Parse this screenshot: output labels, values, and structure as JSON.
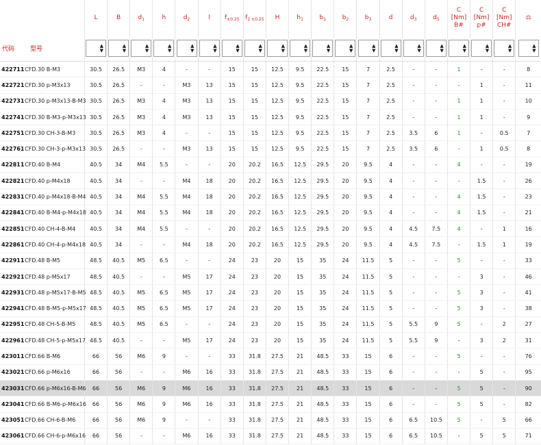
{
  "columns": [
    {
      "key": "L",
      "label": "L"
    },
    {
      "key": "B",
      "label": "B"
    },
    {
      "key": "d1",
      "label": "d",
      "sub": "1"
    },
    {
      "key": "h",
      "label": "h"
    },
    {
      "key": "d2",
      "label": "d",
      "sub": "2"
    },
    {
      "key": "l",
      "label": "l"
    },
    {
      "key": "f025",
      "label": "f",
      "sub": "±0.25"
    },
    {
      "key": "f1",
      "label": "f",
      "sub": "1 ±0.25"
    },
    {
      "key": "H",
      "label": "H"
    },
    {
      "key": "h1",
      "label": "h",
      "sub": "1"
    },
    {
      "key": "b1",
      "label": "b",
      "sub": "1"
    },
    {
      "key": "b2",
      "label": "b",
      "sub": "2"
    },
    {
      "key": "b3",
      "label": "b",
      "sub": "3"
    },
    {
      "key": "d",
      "label": "d"
    },
    {
      "key": "d3",
      "label": "d",
      "sub": "3"
    },
    {
      "key": "d5",
      "label": "d",
      "sub": "5"
    },
    {
      "key": "cb",
      "label": "C\n[Nm] B#"
    },
    {
      "key": "cp",
      "label": "C\n[Nm] p#"
    },
    {
      "key": "cch",
      "label": "C\n[Nm]\nCH#"
    },
    {
      "key": "w",
      "label": "⚖"
    }
  ],
  "header": {
    "code_label": "代码",
    "model_label": "型号"
  },
  "highlight_row": "423031",
  "green_col": "cb",
  "rows": [
    {
      "code": "422711",
      "name": "CFD.30 B-M3",
      "vals": [
        "30.5",
        "26.5",
        "M3",
        "4",
        "-",
        "-",
        "15",
        "15",
        "12.5",
        "9.5",
        "22.5",
        "15",
        "7",
        "2.5",
        "-",
        "-",
        "1",
        "-",
        "-",
        "8"
      ]
    },
    {
      "code": "422721",
      "name": "CFD.30 p-M3x13",
      "vals": [
        "30.5",
        "26.5",
        "-",
        "-",
        "M3",
        "13",
        "15",
        "15",
        "12.5",
        "9.5",
        "22.5",
        "15",
        "7",
        "2.5",
        "-",
        "-",
        "-",
        "1",
        "-",
        "11"
      ]
    },
    {
      "code": "422731",
      "name": "CFD.30 p-M3x13-B-M3",
      "vals": [
        "30.5",
        "26.5",
        "M3",
        "4",
        "M3",
        "13",
        "15",
        "15",
        "12.5",
        "9.5",
        "22.5",
        "15",
        "7",
        "2.5",
        "-",
        "-",
        "1",
        "1",
        "-",
        "10"
      ]
    },
    {
      "code": "422741",
      "name": "CFD.30 B-M3-p-M3x13",
      "vals": [
        "30.5",
        "26.5",
        "M3",
        "4",
        "M3",
        "13",
        "15",
        "15",
        "12.5",
        "9.5",
        "22.5",
        "15",
        "7",
        "2.5",
        "-",
        "-",
        "1",
        "1",
        "-",
        "9"
      ]
    },
    {
      "code": "422751",
      "name": "CFD.30 CH-3-B-M3",
      "vals": [
        "30.5",
        "26.5",
        "M3",
        "4",
        "-",
        "-",
        "15",
        "15",
        "12.5",
        "9.5",
        "22.5",
        "15",
        "7",
        "2.5",
        "3.5",
        "6",
        "1",
        "-",
        "0.5",
        "7"
      ]
    },
    {
      "code": "422761",
      "name": "CFD.30 CH-3-p-M3x13",
      "vals": [
        "30.5",
        "26.5",
        "-",
        "-",
        "M3",
        "13",
        "15",
        "15",
        "12.5",
        "9.5",
        "22.5",
        "15",
        "7",
        "2.5",
        "3.5",
        "6",
        "-",
        "1",
        "0.5",
        "8"
      ]
    },
    {
      "code": "422811",
      "name": "CFD.40 B-M4",
      "vals": [
        "40.5",
        "34",
        "M4",
        "5.5",
        "-",
        "-",
        "20",
        "20.2",
        "16.5",
        "12.5",
        "29.5",
        "20",
        "9.5",
        "4",
        "-",
        "-",
        "4",
        "-",
        "-",
        "19"
      ]
    },
    {
      "code": "422821",
      "name": "CFD.40 p-M4x18",
      "vals": [
        "40.5",
        "34",
        "-",
        "-",
        "M4",
        "18",
        "20",
        "20.2",
        "16.5",
        "12.5",
        "29.5",
        "20",
        "9.5",
        "4",
        "-",
        "-",
        "-",
        "1.5",
        "-",
        "26"
      ]
    },
    {
      "code": "422831",
      "name": "CFD.40 p-M4x18-B-M4",
      "vals": [
        "40.5",
        "34",
        "M4",
        "5.5",
        "M4",
        "18",
        "20",
        "20.2",
        "16.5",
        "12.5",
        "29.5",
        "20",
        "9.5",
        "4",
        "-",
        "-",
        "4",
        "1.5",
        "-",
        "23"
      ]
    },
    {
      "code": "422841",
      "name": "CFD.40 B-M4-p-M4x18",
      "vals": [
        "40.5",
        "34",
        "M4",
        "5.5",
        "M4",
        "18",
        "20",
        "20.2",
        "16.5",
        "12.5",
        "29.5",
        "20",
        "9.5",
        "4",
        "-",
        "-",
        "4",
        "1.5",
        "-",
        "21"
      ]
    },
    {
      "code": "422851",
      "name": "CFD.40 CH-4-B-M4",
      "vals": [
        "40.5",
        "34",
        "M4",
        "5.5",
        "-",
        "-",
        "20",
        "20.2",
        "16.5",
        "12.5",
        "29.5",
        "20",
        "9.5",
        "4",
        "4.5",
        "7.5",
        "4",
        "-",
        "1",
        "16"
      ]
    },
    {
      "code": "422861",
      "name": "CFD.40 CH-4-p-M4x18",
      "vals": [
        "40.5",
        "34",
        "-",
        "-",
        "M4",
        "18",
        "20",
        "20.2",
        "16.5",
        "12.5",
        "29.5",
        "20",
        "9.5",
        "4",
        "4.5",
        "7.5",
        "-",
        "1.5",
        "1",
        "19"
      ]
    },
    {
      "code": "422911",
      "name": "CFD.48 B-M5",
      "vals": [
        "48.5",
        "40.5",
        "M5",
        "6.5",
        "-",
        "-",
        "24",
        "23",
        "20",
        "15",
        "35",
        "24",
        "11.5",
        "5",
        "-",
        "-",
        "5",
        "-",
        "-",
        "33"
      ]
    },
    {
      "code": "422921",
      "name": "CFD.48 p-M5x17",
      "vals": [
        "48.5",
        "40.5",
        "-",
        "-",
        "M5",
        "17",
        "24",
        "23",
        "20",
        "15",
        "35",
        "24",
        "11.5",
        "5",
        "-",
        "-",
        "-",
        "3",
        "-",
        "46"
      ]
    },
    {
      "code": "422931",
      "name": "CFD.48 p-M5x17-B-M5",
      "vals": [
        "48.5",
        "40.5",
        "M5",
        "6.5",
        "M5",
        "17",
        "24",
        "23",
        "20",
        "15",
        "35",
        "24",
        "11.5",
        "5",
        "-",
        "-",
        "5",
        "3",
        "-",
        "41"
      ]
    },
    {
      "code": "422941",
      "name": "CFD.48 B-M5-p-M5x17",
      "vals": [
        "48.5",
        "40.5",
        "M5",
        "6.5",
        "M5",
        "17",
        "24",
        "23",
        "20",
        "15",
        "35",
        "24",
        "11.5",
        "5",
        "-",
        "-",
        "5",
        "3",
        "-",
        "38"
      ]
    },
    {
      "code": "422951",
      "name": "CFD.48 CH-5-B-M5",
      "vals": [
        "48.5",
        "40.5",
        "M5",
        "6.5",
        "-",
        "-",
        "24",
        "23",
        "20",
        "15",
        "35",
        "24",
        "11.5",
        "5",
        "5.5",
        "9",
        "5",
        "-",
        "2",
        "27"
      ]
    },
    {
      "code": "422961",
      "name": "CFD.48 CH-5-p-M5x17",
      "vals": [
        "48.5",
        "40.5",
        "-",
        "-",
        "M5",
        "17",
        "24",
        "23",
        "20",
        "15",
        "35",
        "24",
        "11.5",
        "5",
        "5.5",
        "9",
        "-",
        "3",
        "2",
        "31"
      ]
    },
    {
      "code": "423011",
      "name": "CFD.66 B-M6",
      "vals": [
        "66",
        "56",
        "M6",
        "9",
        "-",
        "-",
        "33",
        "31.8",
        "27.5",
        "21",
        "48.5",
        "33",
        "15",
        "6",
        "-",
        "-",
        "5",
        "-",
        "-",
        "76"
      ]
    },
    {
      "code": "423021",
      "name": "CFD.66 p-M6x16",
      "vals": [
        "66",
        "56",
        "-",
        "-",
        "M6",
        "16",
        "33",
        "31.8",
        "27.5",
        "21",
        "48.5",
        "33",
        "15",
        "6",
        "-",
        "-",
        "-",
        "5",
        "-",
        "95"
      ]
    },
    {
      "code": "423031",
      "name": "CFD.66 p-M6x16-B-M6",
      "vals": [
        "66",
        "56",
        "M6",
        "9",
        "M6",
        "16",
        "33",
        "31.8",
        "27.5",
        "21",
        "48.5",
        "33",
        "15",
        "6",
        "-",
        "-",
        "5",
        "5",
        "-",
        "90"
      ]
    },
    {
      "code": "423041",
      "name": "CFD.66 B-M6-p-M6x16",
      "vals": [
        "66",
        "56",
        "M6",
        "9",
        "M6",
        "16",
        "33",
        "31.8",
        "27.5",
        "21",
        "48.5",
        "33",
        "15",
        "6",
        "-",
        "-",
        "5",
        "5",
        "-",
        "82"
      ]
    },
    {
      "code": "423051",
      "name": "CFD.66 CH-6-B-M6",
      "vals": [
        "66",
        "56",
        "M6",
        "9",
        "-",
        "-",
        "33",
        "31.8",
        "27.5",
        "21",
        "48.5",
        "33",
        "15",
        "6",
        "6.5",
        "10.5",
        "5",
        "-",
        "5",
        "66"
      ]
    },
    {
      "code": "423061",
      "name": "CFD.66 CH-6-p-M6x16",
      "vals": [
        "66",
        "56",
        "-",
        "-",
        "M6",
        "16",
        "33",
        "31.8",
        "27.5",
        "21",
        "48.5",
        "33",
        "15",
        "6",
        "6.5",
        "10.5",
        "-",
        "5",
        "5",
        "71"
      ]
    }
  ]
}
